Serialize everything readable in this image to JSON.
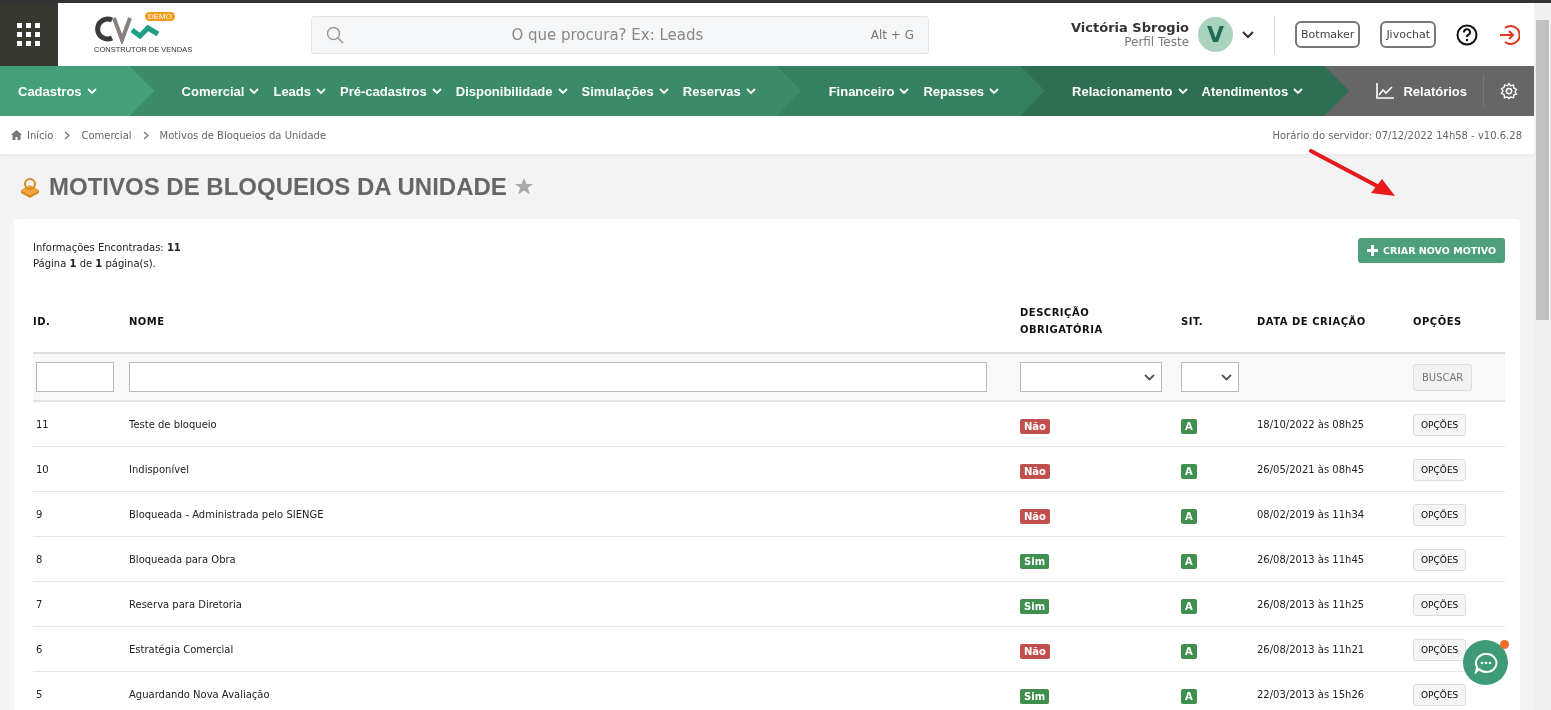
{
  "header": {
    "search": {
      "placeholder": "O que procura? Ex: Leads",
      "shortcut": "Alt + G"
    },
    "user": {
      "name": "Victória Sbrogio",
      "profile": "Perfil Teste",
      "initial": "V"
    },
    "buttons": [
      "Botmaker",
      "Jivochat"
    ],
    "logo": {
      "badge": "DEMO",
      "tagline": "CONSTRUTOR DE VENDAS"
    }
  },
  "nav": {
    "groups": [
      {
        "items": [
          "Cadastros"
        ]
      },
      {
        "items": [
          "Comercial",
          "Leads",
          "Pré-cadastros",
          "Disponibilidade",
          "Simulações",
          "Reservas"
        ]
      },
      {
        "items": [
          "Financeiro",
          "Repasses"
        ]
      },
      {
        "items": [
          "Relacionamento",
          "Atendimentos"
        ]
      }
    ],
    "reports": "Relatórios"
  },
  "breadcrumb": [
    "Início",
    "Comercial",
    "Motivos de Bloqueios da Unidade"
  ],
  "server_time": "Horário do servidor: 07/12/2022 14h58 - v10.6.28",
  "page_title": "MOTIVOS DE BLOQUEIOS DA UNIDADE",
  "summary": [
    "Informações Encontradas: **11**",
    "Página **1** de **1** página(s)."
  ],
  "create_button": "CRIAR NOVO MOTIVO",
  "table": {
    "columns": [
      "ID.",
      "NOME",
      "DESCRIÇÃO OBRIGATÓRIA",
      "SIT.",
      "DATA DE CRIAÇÃO",
      "OPÇÕES"
    ],
    "search_button": "BUSCAR",
    "rows": [
      {
        "id": "11",
        "name": "Teste de bloqueio",
        "required": {
          "label": "Não",
          "kind": "no"
        },
        "status": "A",
        "created": "18/10/2022 às 08h25",
        "options": "OPÇÕES"
      },
      {
        "id": "10",
        "name": "Indisponível",
        "required": {
          "label": "Não",
          "kind": "no"
        },
        "status": "A",
        "created": "26/05/2021 às 08h45",
        "options": "OPÇÕES"
      },
      {
        "id": "9",
        "name": "Bloqueada - Administrada pelo SIENGE",
        "required": {
          "label": "Não",
          "kind": "no"
        },
        "status": "A",
        "created": "08/02/2019 às 11h34",
        "options": "OPÇÕES"
      },
      {
        "id": "8",
        "name": "Bloqueada para Obra",
        "required": {
          "label": "Sim",
          "kind": "yes"
        },
        "status": "A",
        "created": "26/08/2013 às 11h45",
        "options": "OPÇÕES"
      },
      {
        "id": "7",
        "name": "Reserva para Diretoria",
        "required": {
          "label": "Sim",
          "kind": "yes"
        },
        "status": "A",
        "created": "26/08/2013 às 11h25",
        "options": "OPÇÕES"
      },
      {
        "id": "6",
        "name": "Estratégia Comercial",
        "required": {
          "label": "Não",
          "kind": "no"
        },
        "status": "A",
        "created": "26/08/2013 às 11h21",
        "options": "OPÇÕES"
      },
      {
        "id": "5",
        "name": "Aguardando Nova Avaliação",
        "required": {
          "label": "Sim",
          "kind": "yes"
        },
        "status": "A",
        "created": "22/03/2013 às 15h26",
        "options": "OPÇÕES"
      }
    ]
  }
}
